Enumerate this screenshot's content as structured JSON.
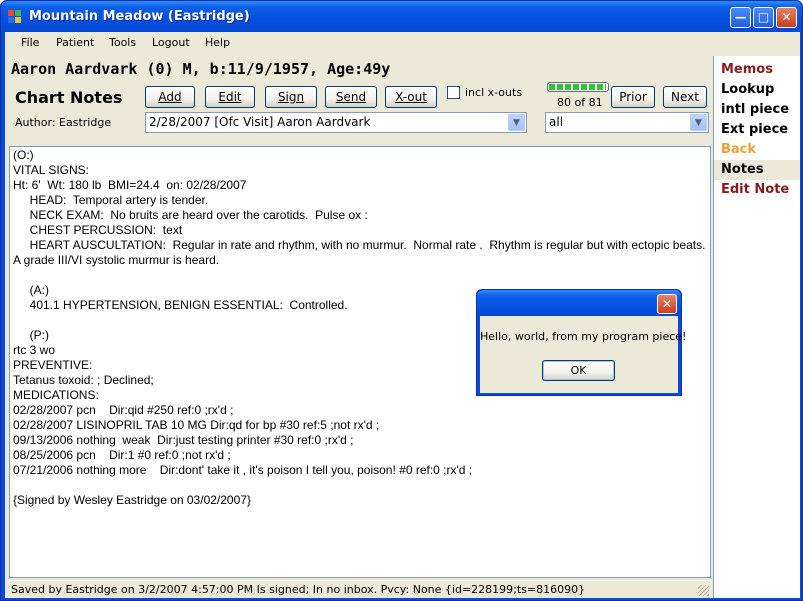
{
  "window": {
    "title": "Mountain Meadow (Eastridge)",
    "minimize_icon": "minimize-icon",
    "maximize_icon": "maximize-icon",
    "close_icon": "close-icon",
    "minimize_glyph": "—",
    "maximize_glyph": "□",
    "close_glyph": "✕"
  },
  "menu": [
    "File",
    "Patient",
    "Tools",
    "Logout",
    "Help"
  ],
  "patient": {
    "header": "Aaron Aardvark (0) M, b:11/9/1957, Age:49y"
  },
  "toolbar": {
    "section_title": "Chart Notes",
    "author": "Author: Eastridge",
    "buttons": {
      "add": "Add",
      "edit": "Edit",
      "sign": "Sign",
      "send": "Send",
      "xout": "X-out",
      "prior": "Prior",
      "next": "Next"
    },
    "incl_xouts_label": "incl x-outs",
    "incl_xouts_checked": false,
    "position_text": "80 of 81",
    "position_fraction": 0.99,
    "note_select": "2/28/2007   [Ofc Visit]   Aaron Aardvark",
    "filter_select": "all"
  },
  "note": {
    "text": "(O:)\nVITAL SIGNS:\nHt: 6'  Wt: 180 lb  BMI=24.4  on: 02/28/2007\n     HEAD:  Temporal artery is tender.\n     NECK EXAM:  No bruits are heard over the carotids.  Pulse ox :\n     CHEST PERCUSSION:  text\n     HEART AUSCULTATION:  Regular in rate and rhythm, with no murmur.  Normal rate .  Rhythm is regular but with ectopic beats.  A grade III/VI systolic murmur is heard.\n\n     (A:)\n     401.1 HYPERTENSION, BENIGN ESSENTIAL:  Controlled.\n\n     (P:)\nrtc 3 wo\nPREVENTIVE:\nTetanus toxoid: ; Declined;\nMEDICATIONS:\n02/28/2007 pcn    Dir:qid #250 ref:0 ;rx'd ;\n02/28/2007 LISINOPRIL TAB 10 MG Dir:qd for bp #30 ref:5 ;not rx'd ;\n09/13/2006 nothing  weak  Dir:just testing printer #30 ref:0 ;rx'd ;\n08/25/2006 pcn    Dir:1 #0 ref:0 ;not rx'd ;\n07/21/2006 nothing more    Dir:dont' take it , it's poison I tell you, poison! #0 ref:0 ;rx'd ;\n\n{Signed by Wesley Eastridge on 03/02/2007}"
  },
  "status": {
    "text": "Saved by Eastridge on 3/2/2007 4:57:00 PM Is signed;  In no inbox. Pvcy: None {id=228199;ts=816090}"
  },
  "right_panel": [
    {
      "label": "Memos",
      "color": "#8b1a1a",
      "selected": false
    },
    {
      "label": "Lookup",
      "color": "#000000",
      "selected": false
    },
    {
      "label": "intl piece",
      "color": "#000000",
      "selected": false
    },
    {
      "label": "Ext piece",
      "color": "#000000",
      "selected": false
    },
    {
      "label": "Back",
      "color": "#f0a030",
      "selected": false
    },
    {
      "label": "Notes",
      "color": "#000000",
      "selected": true
    },
    {
      "label": "Edit Note",
      "color": "#8b1a1a",
      "selected": false
    }
  ],
  "dialog": {
    "message": "Hello, world, from my program piece!",
    "ok_label": "OK",
    "close_glyph": "✕"
  }
}
